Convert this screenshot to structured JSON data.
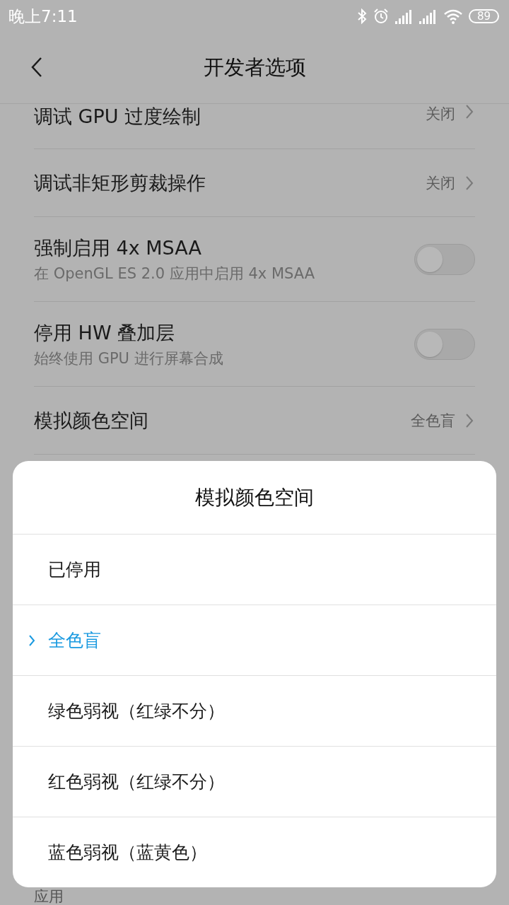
{
  "status_bar": {
    "time": "晚上7:11",
    "battery": "89"
  },
  "header": {
    "title": "开发者选项"
  },
  "settings": [
    {
      "kind": "link",
      "title": "调试 GPU 过度绘制",
      "value": "关闭"
    },
    {
      "kind": "link",
      "title": "调试非矩形剪裁操作",
      "value": "关闭"
    },
    {
      "kind": "toggle",
      "title": "强制启用 4x MSAA",
      "subtitle": "在 OpenGL ES 2.0 应用中启用 4x MSAA",
      "on": false
    },
    {
      "kind": "toggle",
      "title": "停用 HW 叠加层",
      "subtitle": "始终使用 GPU 进行屏幕合成",
      "on": false
    },
    {
      "kind": "link",
      "title": "模拟颜色空间",
      "value": "全色盲"
    }
  ],
  "section_label": "应用",
  "dialog": {
    "title": "模拟颜色空间",
    "options": [
      {
        "label": "已停用",
        "selected": false
      },
      {
        "label": "全色盲",
        "selected": true
      },
      {
        "label": "绿色弱视（红绿不分）",
        "selected": false
      },
      {
        "label": "红色弱视（红绿不分）",
        "selected": false
      },
      {
        "label": "蓝色弱视（蓝黄色）",
        "selected": false
      }
    ]
  }
}
